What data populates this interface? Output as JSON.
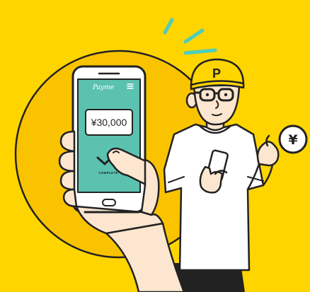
{
  "app_name": "Payme",
  "payment": {
    "amount": "¥30,000",
    "status": "COMPLETE"
  },
  "cap_letter": "P",
  "coin_symbol": "¥",
  "colors": {
    "background": "#FFD500",
    "circle": "#FAC300",
    "screen": "#5CC2B0",
    "outline": "#222222",
    "skin": "#FCE6CF",
    "cap": "#FFD500",
    "accent_sparkles": "#4CCDBB"
  },
  "icons": {
    "menu": "hamburger-menu-icon",
    "checkmark": "checkmark-icon",
    "coin": "yen-coin-icon"
  }
}
